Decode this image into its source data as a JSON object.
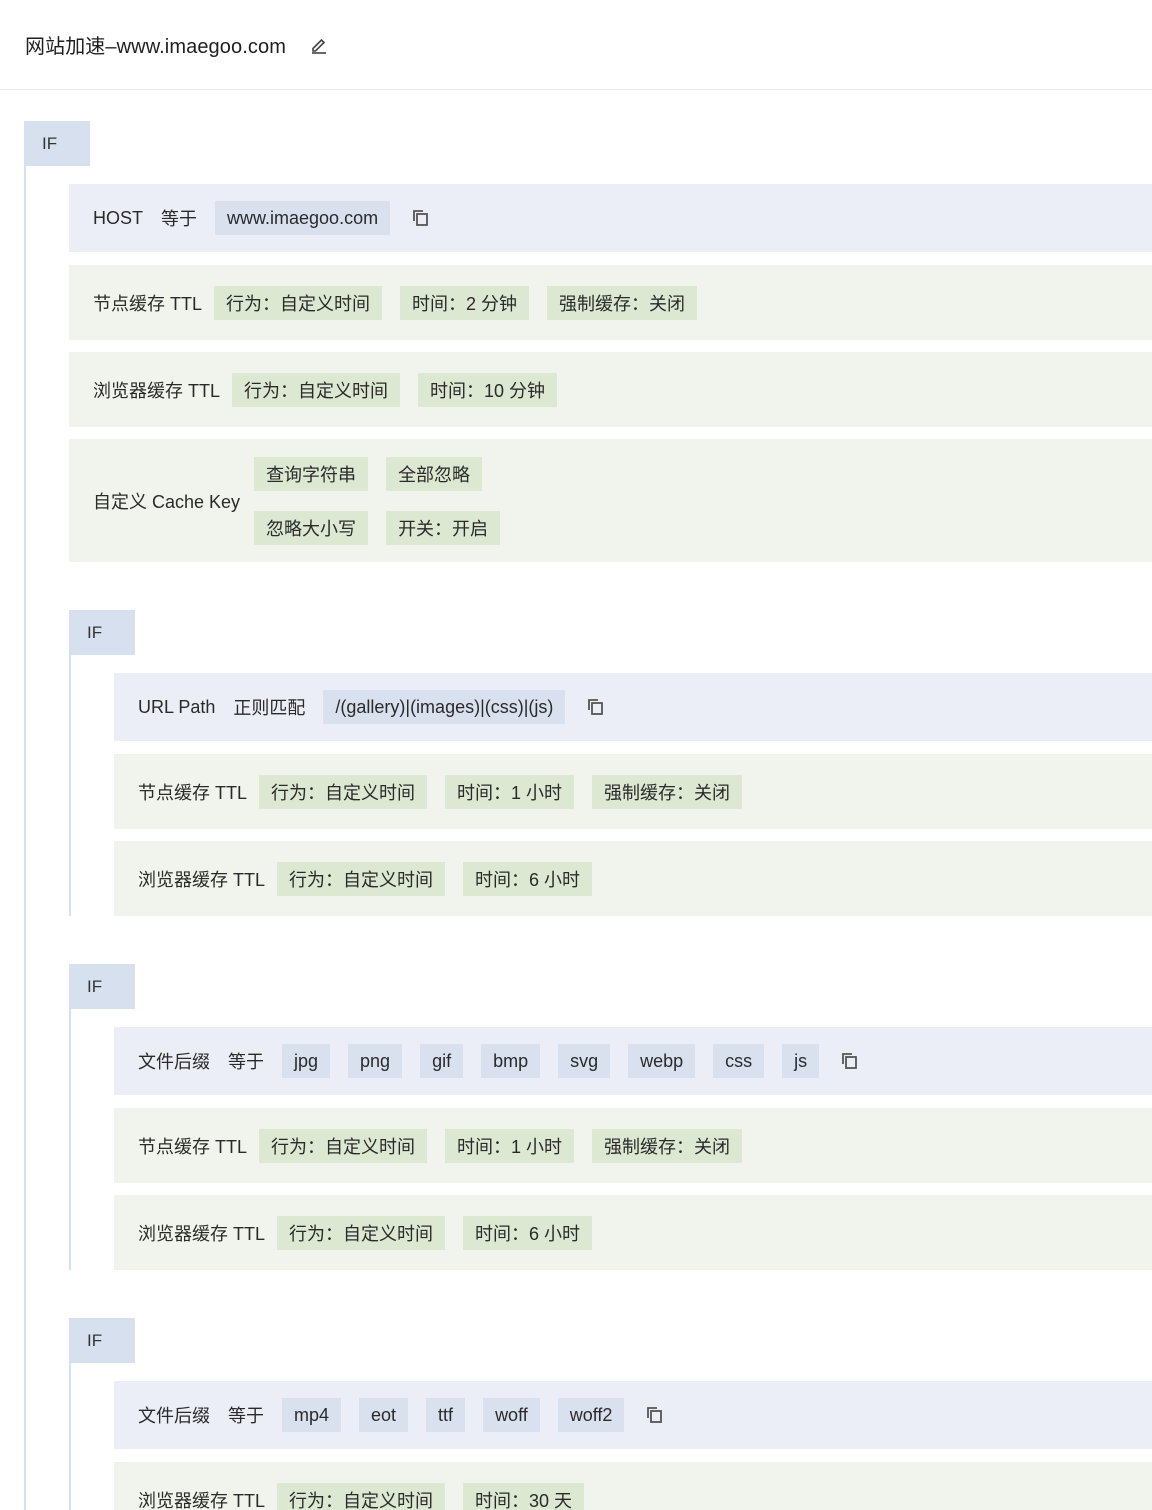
{
  "header": {
    "title": "网站加速–www.imaegoo.com",
    "edit_icon": "pencil-icon"
  },
  "rules": {
    "r1": {
      "if_label": "IF",
      "host": {
        "field": "HOST",
        "op": "等于",
        "value": "www.imaegoo.com"
      },
      "node_ttl": {
        "label": "节点缓存 TTL",
        "behavior": "行为：自定义时间",
        "time": "时间：2 分钟",
        "force": "强制缓存：关闭"
      },
      "browser_ttl": {
        "label": "浏览器缓存 TTL",
        "behavior": "行为：自定义时间",
        "time": "时间：10 分钟"
      },
      "cache_key": {
        "label": "自定义 Cache Key",
        "query": "查询字符串",
        "query_val": "全部忽略",
        "case": "忽略大小写",
        "case_val": "开关：开启"
      }
    },
    "r2": {
      "if_label": "IF",
      "cond": {
        "field": "URL Path",
        "op": "正则匹配",
        "value": "/(gallery)|(images)|(css)|(js)"
      },
      "node_ttl": {
        "label": "节点缓存 TTL",
        "behavior": "行为：自定义时间",
        "time": "时间：1 小时",
        "force": "强制缓存：关闭"
      },
      "browser_ttl": {
        "label": "浏览器缓存 TTL",
        "behavior": "行为：自定义时间",
        "time": "时间：6 小时"
      }
    },
    "r3": {
      "if_label": "IF",
      "cond": {
        "field": "文件后缀",
        "op": "等于",
        "values": [
          "jpg",
          "png",
          "gif",
          "bmp",
          "svg",
          "webp",
          "css",
          "js"
        ]
      },
      "node_ttl": {
        "label": "节点缓存 TTL",
        "behavior": "行为：自定义时间",
        "time": "时间：1 小时",
        "force": "强制缓存：关闭"
      },
      "browser_ttl": {
        "label": "浏览器缓存 TTL",
        "behavior": "行为：自定义时间",
        "time": "时间：6 小时"
      }
    },
    "r4": {
      "if_label": "IF",
      "cond": {
        "field": "文件后缀",
        "op": "等于",
        "values": [
          "mp4",
          "eot",
          "ttf",
          "woff",
          "woff2"
        ]
      },
      "browser_ttl": {
        "label": "浏览器缓存 TTL",
        "behavior": "行为：自定义时间",
        "time": "时间：30 天"
      }
    }
  }
}
